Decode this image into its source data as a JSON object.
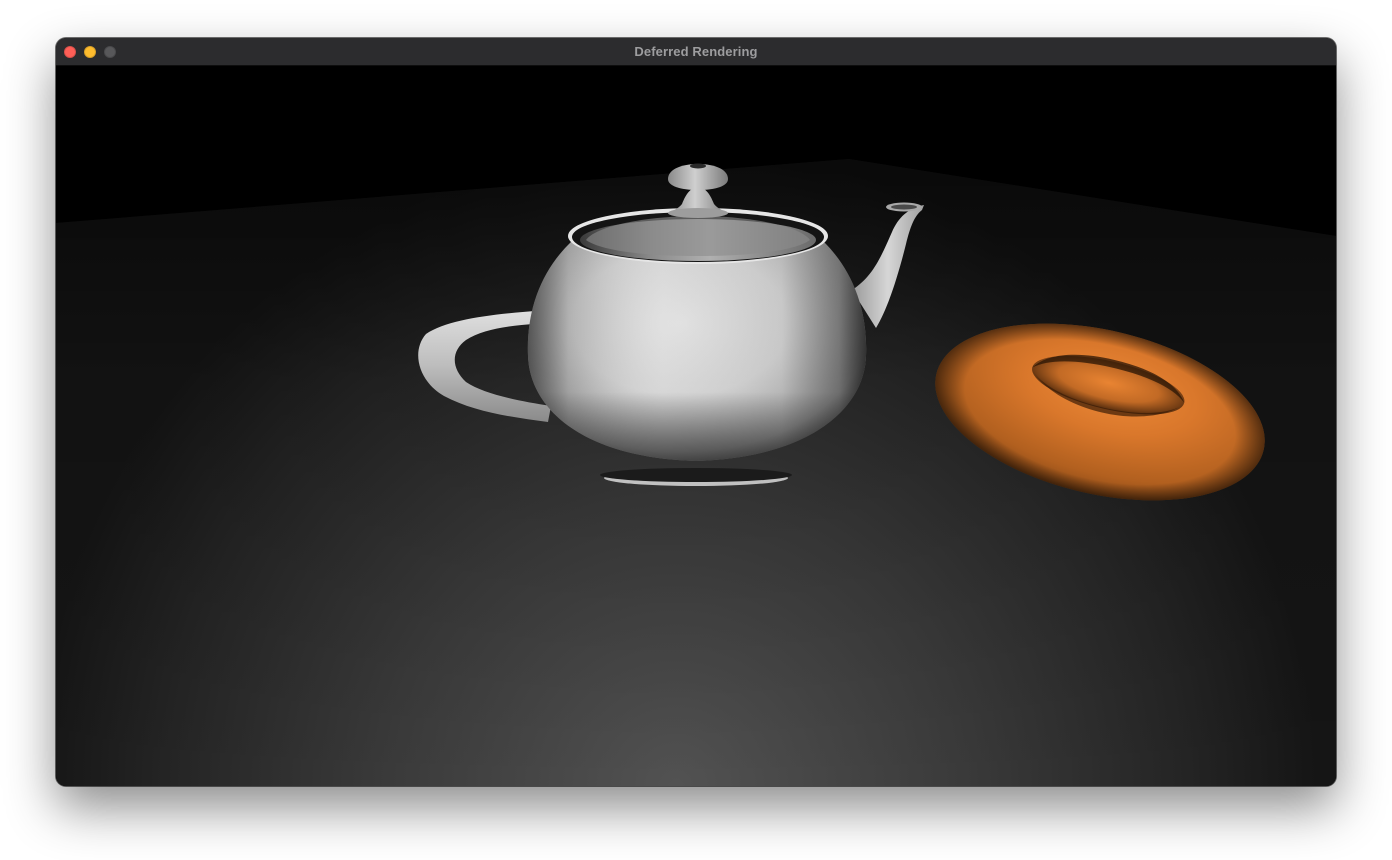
{
  "window": {
    "title": "Deferred Rendering",
    "traffic_lights": [
      {
        "name": "close",
        "color": "#ff5f57"
      },
      {
        "name": "minimize",
        "color": "#febc2e"
      },
      {
        "name": "zoom",
        "color": "#58585a"
      }
    ]
  },
  "scene": {
    "clear_color": "#000000",
    "floor_color_near": "#505050",
    "floor_color_far": "#101010",
    "teapot_color": "#d2d2d2",
    "torus_color": "#e27d2e"
  }
}
